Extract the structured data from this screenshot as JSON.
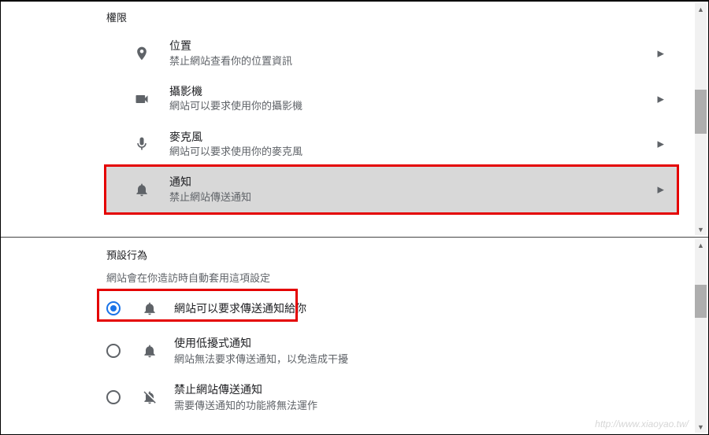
{
  "top": {
    "section_title": "權限",
    "items": [
      {
        "icon": "location-icon",
        "title": "位置",
        "desc": "禁止網站查看你的位置資訊"
      },
      {
        "icon": "camera-icon",
        "title": "攝影機",
        "desc": "網站可以要求使用你的攝影機"
      },
      {
        "icon": "mic-icon",
        "title": "麥克風",
        "desc": "網站可以要求使用你的麥克風"
      },
      {
        "icon": "bell-icon",
        "title": "通知",
        "desc": "禁止網站傳送通知",
        "highlighted": true
      }
    ]
  },
  "bottom": {
    "section_title": "預設行為",
    "section_desc": "網站會在你造訪時自動套用這項設定",
    "options": [
      {
        "icon": "bell-icon",
        "title": "網站可以要求傳送通知給你",
        "desc": "",
        "selected": true,
        "highlighted": true
      },
      {
        "icon": "bell-icon",
        "title": "使用低擾式通知",
        "desc": "網站無法要求傳送通知，以免造成干擾",
        "selected": false
      },
      {
        "icon": "bell-off-icon",
        "title": "禁止網站傳送通知",
        "desc": "需要傳送通知的功能將無法運作",
        "selected": false
      }
    ]
  },
  "watermark": "http://www.xiaoyao.tw/"
}
